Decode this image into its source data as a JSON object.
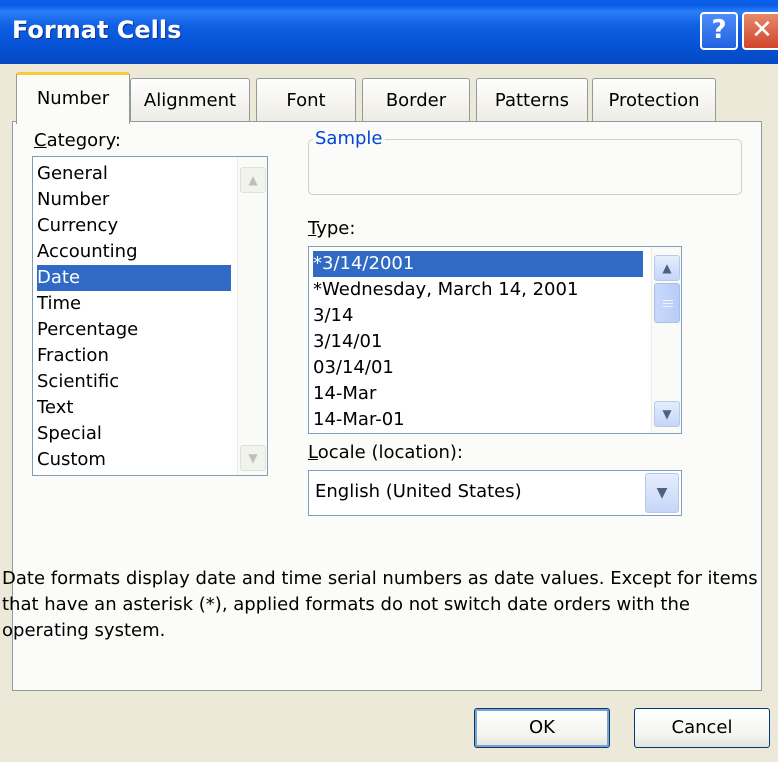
{
  "window": {
    "title": "Format Cells",
    "help_label": "?",
    "close_label": "✕"
  },
  "tabs": [
    {
      "label": "Number",
      "active": true
    },
    {
      "label": "Alignment"
    },
    {
      "label": "Font"
    },
    {
      "label": "Border"
    },
    {
      "label": "Patterns"
    },
    {
      "label": "Protection"
    }
  ],
  "category": {
    "label": "Category:",
    "items": [
      "General",
      "Number",
      "Currency",
      "Accounting",
      "Date",
      "Time",
      "Percentage",
      "Fraction",
      "Scientific",
      "Text",
      "Special",
      "Custom"
    ],
    "selected": "Date"
  },
  "sample": {
    "label": "Sample",
    "value": ""
  },
  "type": {
    "label": "Type:",
    "items": [
      "*3/14/2001",
      "*Wednesday, March 14, 2001",
      "3/14",
      "3/14/01",
      "03/14/01",
      "14-Mar",
      "14-Mar-01"
    ],
    "selected": "*3/14/2001"
  },
  "locale": {
    "label": "Locale (location):",
    "value": "English (United States)"
  },
  "description": "Date formats display date and time serial numbers as date values. Except for items that have an asterisk (*), applied formats do not switch date orders with the operating system.",
  "buttons": {
    "ok": "OK",
    "cancel": "Cancel"
  },
  "icons": {
    "scroll_up": "▲",
    "scroll_down": "▼",
    "dropdown": "▼"
  },
  "colors": {
    "titlebar": "#0A5CE6",
    "selection": "#316AC5",
    "active_tab_accent": "#FFC83C",
    "group_title": "#0046D5"
  }
}
